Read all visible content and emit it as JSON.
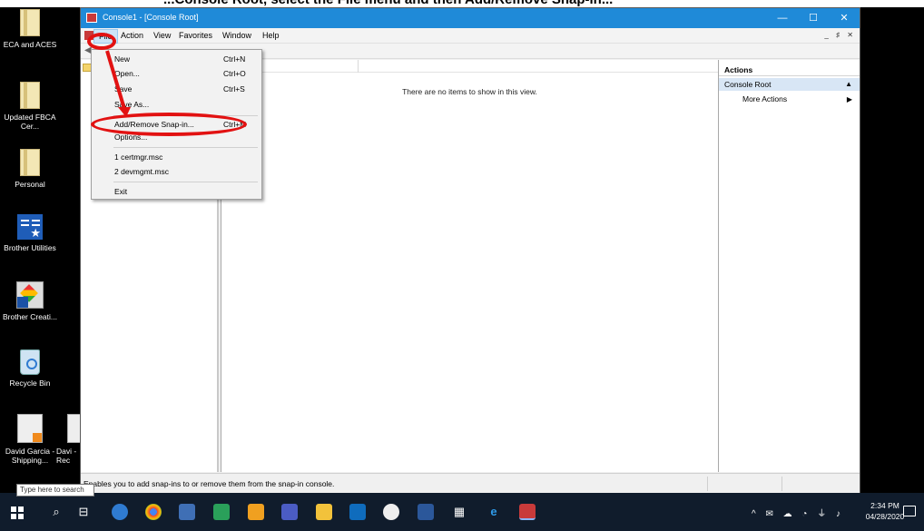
{
  "caption": "...Console Root, select the File menu and then Add/Remove Snap-in...",
  "desktop": {
    "icons": [
      {
        "label": "ECA and ACES"
      },
      {
        "label": "Updated FBCA Cer..."
      },
      {
        "label": "Personal"
      },
      {
        "label": "Brother Utilities"
      },
      {
        "label": "Brother Creati..."
      },
      {
        "label": "Recycle Bin"
      },
      {
        "label": "David Garcia - Shipping..."
      },
      {
        "label": "Davi - Rec"
      }
    ]
  },
  "window": {
    "title": "Console1 - [Console Root]",
    "minimize": "—",
    "maximize": "☐",
    "close": "✕"
  },
  "menubar": {
    "items": [
      "File",
      "Action",
      "View",
      "Favorites",
      "Window",
      "Help"
    ],
    "mdi_controls": "_ ♯ ✕"
  },
  "file_menu": {
    "items": [
      {
        "label": "New",
        "shortcut": "Ctrl+N"
      },
      {
        "label": "Open...",
        "shortcut": "Ctrl+O"
      },
      {
        "label": "Save",
        "shortcut": "Ctrl+S"
      },
      {
        "label": "Save As...",
        "shortcut": ""
      },
      {
        "label": "Add/Remove Snap-in...",
        "shortcut": "Ctrl+M"
      },
      {
        "label": "Options...",
        "shortcut": ""
      },
      {
        "label": "1 certmgr.msc",
        "shortcut": ""
      },
      {
        "label": "2 devmgmt.msc",
        "shortcut": ""
      },
      {
        "label": "Exit",
        "shortcut": ""
      }
    ]
  },
  "center": {
    "empty_message": "There are no items to show in this view."
  },
  "actions": {
    "header": "Actions",
    "section": "Console Root",
    "more": "More Actions"
  },
  "status": {
    "text": "Enables you to add snap-ins to or remove them from the snap-in console."
  },
  "taskbar": {
    "search_placeholder": "Type here to search",
    "time": "2:34 PM",
    "date": "04/28/2020"
  },
  "colors": {
    "annotation": "#e21212",
    "titlebar": "#1f8ad8",
    "taskbar": "#101c2c"
  }
}
